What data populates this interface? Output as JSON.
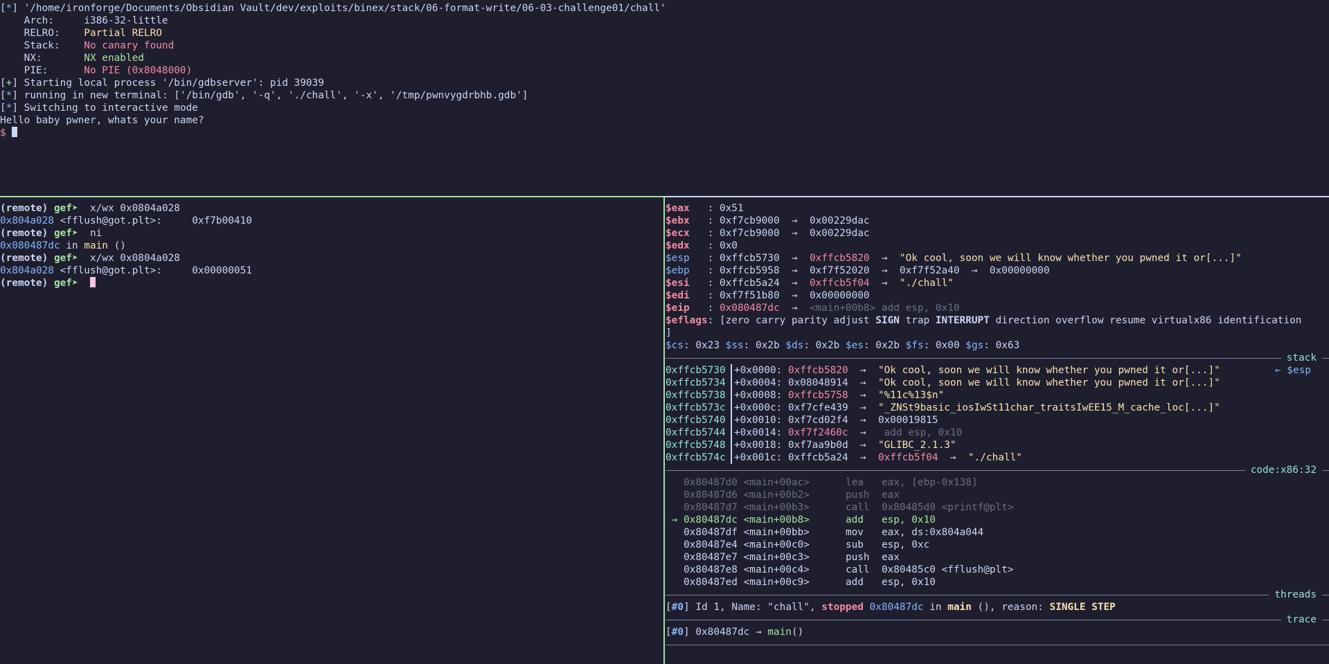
{
  "top": {
    "path_line_tag": "*",
    "path_line_text": " '/home/ironforge/Documents/Obsidian Vault/dev/exploits/binex/stack/06-format-write/06-03-challenge01/chall'",
    "arch_label": "    Arch:     ",
    "arch_value": "i386-32-little",
    "relro_label": "    RELRO:    ",
    "relro_value": "Partial RELRO",
    "stack_label": "    Stack:    ",
    "stack_value": "No canary found",
    "nx_label": "    NX:       ",
    "nx_value": "NX enabled",
    "pie_label": "    PIE:      ",
    "pie_value": "No PIE (0x8048000)",
    "start_tag": "+",
    "start_text": " Starting local process '/bin/gdbserver': pid 39039",
    "run_tag": "*",
    "run_text": " running in new terminal: ['/bin/gdb', '-q', './chall', '-x', '/tmp/pwnvygdrbhb.gdb']",
    "switch_tag": "*",
    "switch_text": " Switching to interactive mode",
    "hello": "Hello baby pwner, whats your name?",
    "prompt": "$ "
  },
  "gdb": {
    "remote": "(remote) ",
    "gef": "gef➤ ",
    "cmd1": " x/wx 0x0804a028",
    "out1_addr": "0x804a028",
    "out1_sym": " <fflush@got.plt>:     0xf7b00410",
    "cmd2": " ni",
    "out2_addr": "0x080487dc",
    "out2_in": " in ",
    "out2_fn": "main",
    "out2_tail": " ()",
    "cmd3": " x/wx 0x0804a028",
    "out3_addr": "0x804a028",
    "out3_sym": " <fflush@got.plt>:     0x00000051"
  },
  "registers": [
    {
      "name": "$eax",
      "pad": "   ",
      "color": "red",
      "rest": ": 0x51"
    },
    {
      "name": "$ebx",
      "pad": "   ",
      "color": "red",
      "rest": ": 0xf7cb9000  →  0x00229dac"
    },
    {
      "name": "$ecx",
      "pad": "   ",
      "color": "red",
      "rest": ": 0xf7cb9000  →  0x00229dac"
    },
    {
      "name": "$edx",
      "pad": "   ",
      "color": "red",
      "rest": ": 0x0"
    },
    {
      "name": "$esp",
      "pad": "   ",
      "color": "blue",
      "pre": ": 0xffcb5730  →  ",
      "p1": "0xffcb5820",
      "mid": "  →  ",
      "str": "\"Ok cool, soon we will know whether you pwned it or[...]\""
    },
    {
      "name": "$ebp",
      "pad": "   ",
      "color": "blue",
      "rest": ": 0xffcb5958  →  0xf7f52020  →  0xf7f52a40  →  0x00000000"
    },
    {
      "name": "$esi",
      "pad": "   ",
      "color": "red",
      "pre": ": 0xffcb5a24  →  ",
      "p1": "0xffcb5f04",
      "mid": "  →  ",
      "str": "\"./chall\""
    },
    {
      "name": "$edi",
      "pad": "   ",
      "color": "red",
      "rest": ": 0xf7f51b80  →  0x00000000"
    },
    {
      "name": "$eip",
      "pad": "   ",
      "color": "red",
      "eip": true,
      "pre": ": ",
      "p1": "0x080487dc",
      "mid": "  →  ",
      "dim": "<main+00b8> add esp, 0x10"
    }
  ],
  "eflags": {
    "name": "$eflags",
    "open": ": [zero carry parity adjust ",
    "sign": "SIGN",
    "trap": " trap ",
    "interrupt": "INTERRUPT",
    "tail": " direction overflow resume virtualx86 identification",
    "close": "]"
  },
  "segments": [
    {
      "name": "$cs",
      "val": ": 0x23 "
    },
    {
      "name": "$ss",
      "val": ": 0x2b "
    },
    {
      "name": "$ds",
      "val": ": 0x2b "
    },
    {
      "name": "$es",
      "val": ": 0x2b "
    },
    {
      "name": "$fs",
      "val": ": 0x00 "
    },
    {
      "name": "$gs",
      "val": ": 0x63"
    }
  ],
  "section_titles": {
    "stack": "stack",
    "code": "code:x86:32",
    "threads": "threads",
    "trace": "trace"
  },
  "esp_marker": "← $esp",
  "stack": [
    {
      "addr": "0xffcb5730",
      "off": "+0x0000: ",
      "val": "0xffcb5820",
      "val_color": "red",
      "arrow": "  →  ",
      "str": "\"Ok cool, soon we will know whether you pwned it or[...]\""
    },
    {
      "addr": "0xffcb5734",
      "off": "+0x0004: ",
      "val": "0x08048914",
      "val_color": "white",
      "arrow": "  →  ",
      "str": "\"Ok cool, soon we will know whether you pwned it or[...]\""
    },
    {
      "addr": "0xffcb5738",
      "off": "+0x0008: ",
      "val": "0xffcb5758",
      "val_color": "red",
      "arrow": "  →  ",
      "str": "\"%11c%13$n\""
    },
    {
      "addr": "0xffcb573c",
      "off": "+0x000c: ",
      "val": "0xf7cfe439",
      "val_color": "white",
      "arrow": "  →  ",
      "str": "\"_ZNSt9basic_iosIwSt11char_traitsIwEE15_M_cache_loc[...]\""
    },
    {
      "addr": "0xffcb5740",
      "off": "+0x0010: ",
      "val": "0xf7cd02f4",
      "val_color": "white",
      "arrow": "  →  ",
      "plain": "0x00019815"
    },
    {
      "addr": "0xffcb5744",
      "off": "+0x0014: ",
      "val": "0xf7f2460c",
      "val_color": "red",
      "arrow": "  →   ",
      "dim": "add esp, 0x10"
    },
    {
      "addr": "0xffcb5748",
      "off": "+0x0018: ",
      "val": "0xf7aa9b0d",
      "val_color": "white",
      "arrow": "  →  ",
      "str": "\"GLIBC_2.1.3\""
    },
    {
      "addr": "0xffcb574c",
      "off": "+0x001c: ",
      "val": "0xffcb5a24",
      "val_color": "white",
      "arrow": "  →  ",
      "p2": "0xffcb5f04",
      "arrow2": "  →  ",
      "str": "\"./chall\""
    }
  ],
  "code": [
    {
      "marker": "   ",
      "addr": "0x80487d0",
      "sym": " <main+00ac>",
      "mnem": "lea",
      "ops": "eax, [ebp-0x138]",
      "state": "past"
    },
    {
      "marker": "   ",
      "addr": "0x80487d6",
      "sym": " <main+00b2>",
      "mnem": "push",
      "ops": "eax",
      "state": "past"
    },
    {
      "marker": "   ",
      "addr": "0x80487d7",
      "sym": " <main+00b3>",
      "mnem": "call",
      "ops": "0x80485d0 <printf@plt>",
      "state": "past"
    },
    {
      "marker": " → ",
      "addr": "0x80487dc",
      "sym": " <main+00b8>",
      "mnem": "add",
      "ops": "esp, 0x10",
      "state": "current"
    },
    {
      "marker": "   ",
      "addr": "0x80487df",
      "sym": " <main+00bb>",
      "mnem": "mov",
      "ops": "eax, ds:0x804a044",
      "state": "next"
    },
    {
      "marker": "   ",
      "addr": "0x80487e4",
      "sym": " <main+00c0>",
      "mnem": "sub",
      "ops": "esp, 0xc",
      "state": "next"
    },
    {
      "marker": "   ",
      "addr": "0x80487e7",
      "sym": " <main+00c3>",
      "mnem": "push",
      "ops": "eax",
      "state": "next"
    },
    {
      "marker": "   ",
      "addr": "0x80487e8",
      "sym": " <main+00c4>",
      "mnem": "call",
      "ops": "0x80485c0 <fflush@plt>",
      "state": "next"
    },
    {
      "marker": "   ",
      "addr": "0x80487ed",
      "sym": " <main+00c9>",
      "mnem": "add",
      "ops": "esp, 0x10",
      "state": "next"
    }
  ],
  "threads": {
    "open": "[",
    "id": "#0",
    "close": "]",
    "pre": " Id 1, Name: \"chall\", ",
    "stopped": "stopped",
    "addr": " 0x80487dc",
    "in": " in ",
    "fn": "main",
    "mid": " (), reason: ",
    "reason": "SINGLE STEP"
  },
  "trace": {
    "open": "[",
    "id": "#0",
    "close": "]",
    "pre": " 0x80487dc → ",
    "fn": "main",
    "tail": "()"
  }
}
